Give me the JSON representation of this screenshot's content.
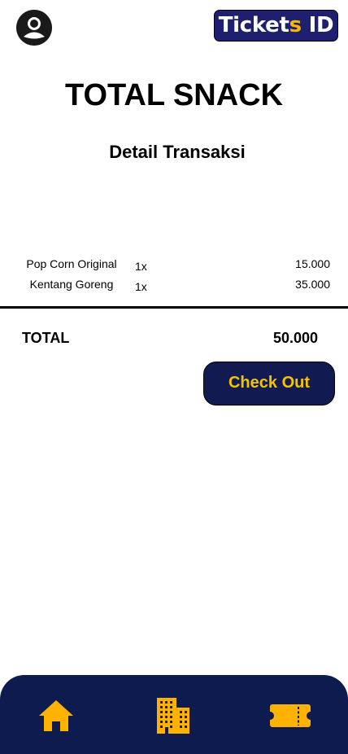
{
  "header": {
    "avatar_icon": "user-avatar-icon",
    "brand": {
      "prefix": "Ticket",
      "accent": "s",
      "suffix": " ID"
    }
  },
  "page_title": "TOTAL SNACK",
  "section_title": "Detail Transaksi",
  "items": [
    {
      "name": "Pop Corn Original",
      "qty": "1x",
      "price": "15.000"
    },
    {
      "name": "Kentang Goreng",
      "qty": "1x",
      "price": "35.000"
    }
  ],
  "total": {
    "label": "TOTAL",
    "value": "50.000"
  },
  "checkout": {
    "label": "Check Out"
  },
  "bottom_nav": {
    "items": [
      {
        "icon": "home-icon"
      },
      {
        "icon": "cinema-building-icon"
      },
      {
        "icon": "ticket-icon"
      }
    ]
  },
  "colors": {
    "navy": "#0e1b4f",
    "brand_bg": "#1e1f6e",
    "accent_yellow": "#f5b800",
    "button_text": "#f5c400",
    "nav_icon": "#ffb300"
  }
}
